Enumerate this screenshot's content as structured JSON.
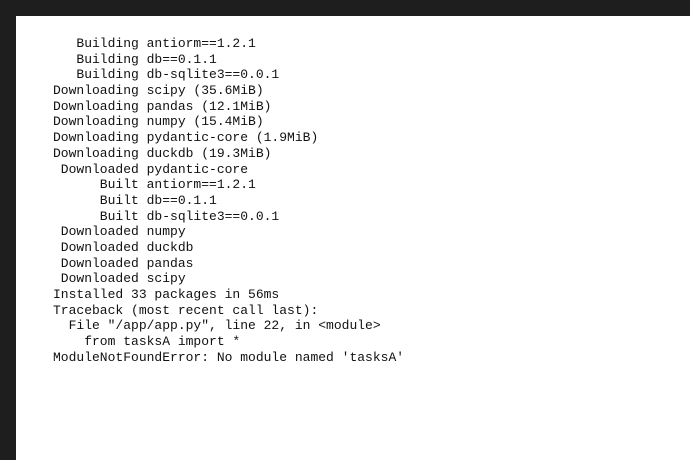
{
  "terminal": {
    "lines": [
      "   Building antiorm==1.2.1",
      "   Building db==0.1.1",
      "   Building db-sqlite3==0.0.1",
      "Downloading scipy (35.6MiB)",
      "Downloading pandas (12.1MiB)",
      "Downloading numpy (15.4MiB)",
      "Downloading pydantic-core (1.9MiB)",
      "Downloading duckdb (19.3MiB)",
      " Downloaded pydantic-core",
      "      Built antiorm==1.2.1",
      "      Built db==0.1.1",
      "      Built db-sqlite3==0.0.1",
      " Downloaded numpy",
      " Downloaded duckdb",
      " Downloaded pandas",
      " Downloaded scipy",
      "Installed 33 packages in 56ms",
      "Traceback (most recent call last):",
      "  File \"/app/app.py\", line 22, in <module>",
      "    from tasksA import *",
      "ModuleNotFoundError: No module named 'tasksA'"
    ]
  }
}
